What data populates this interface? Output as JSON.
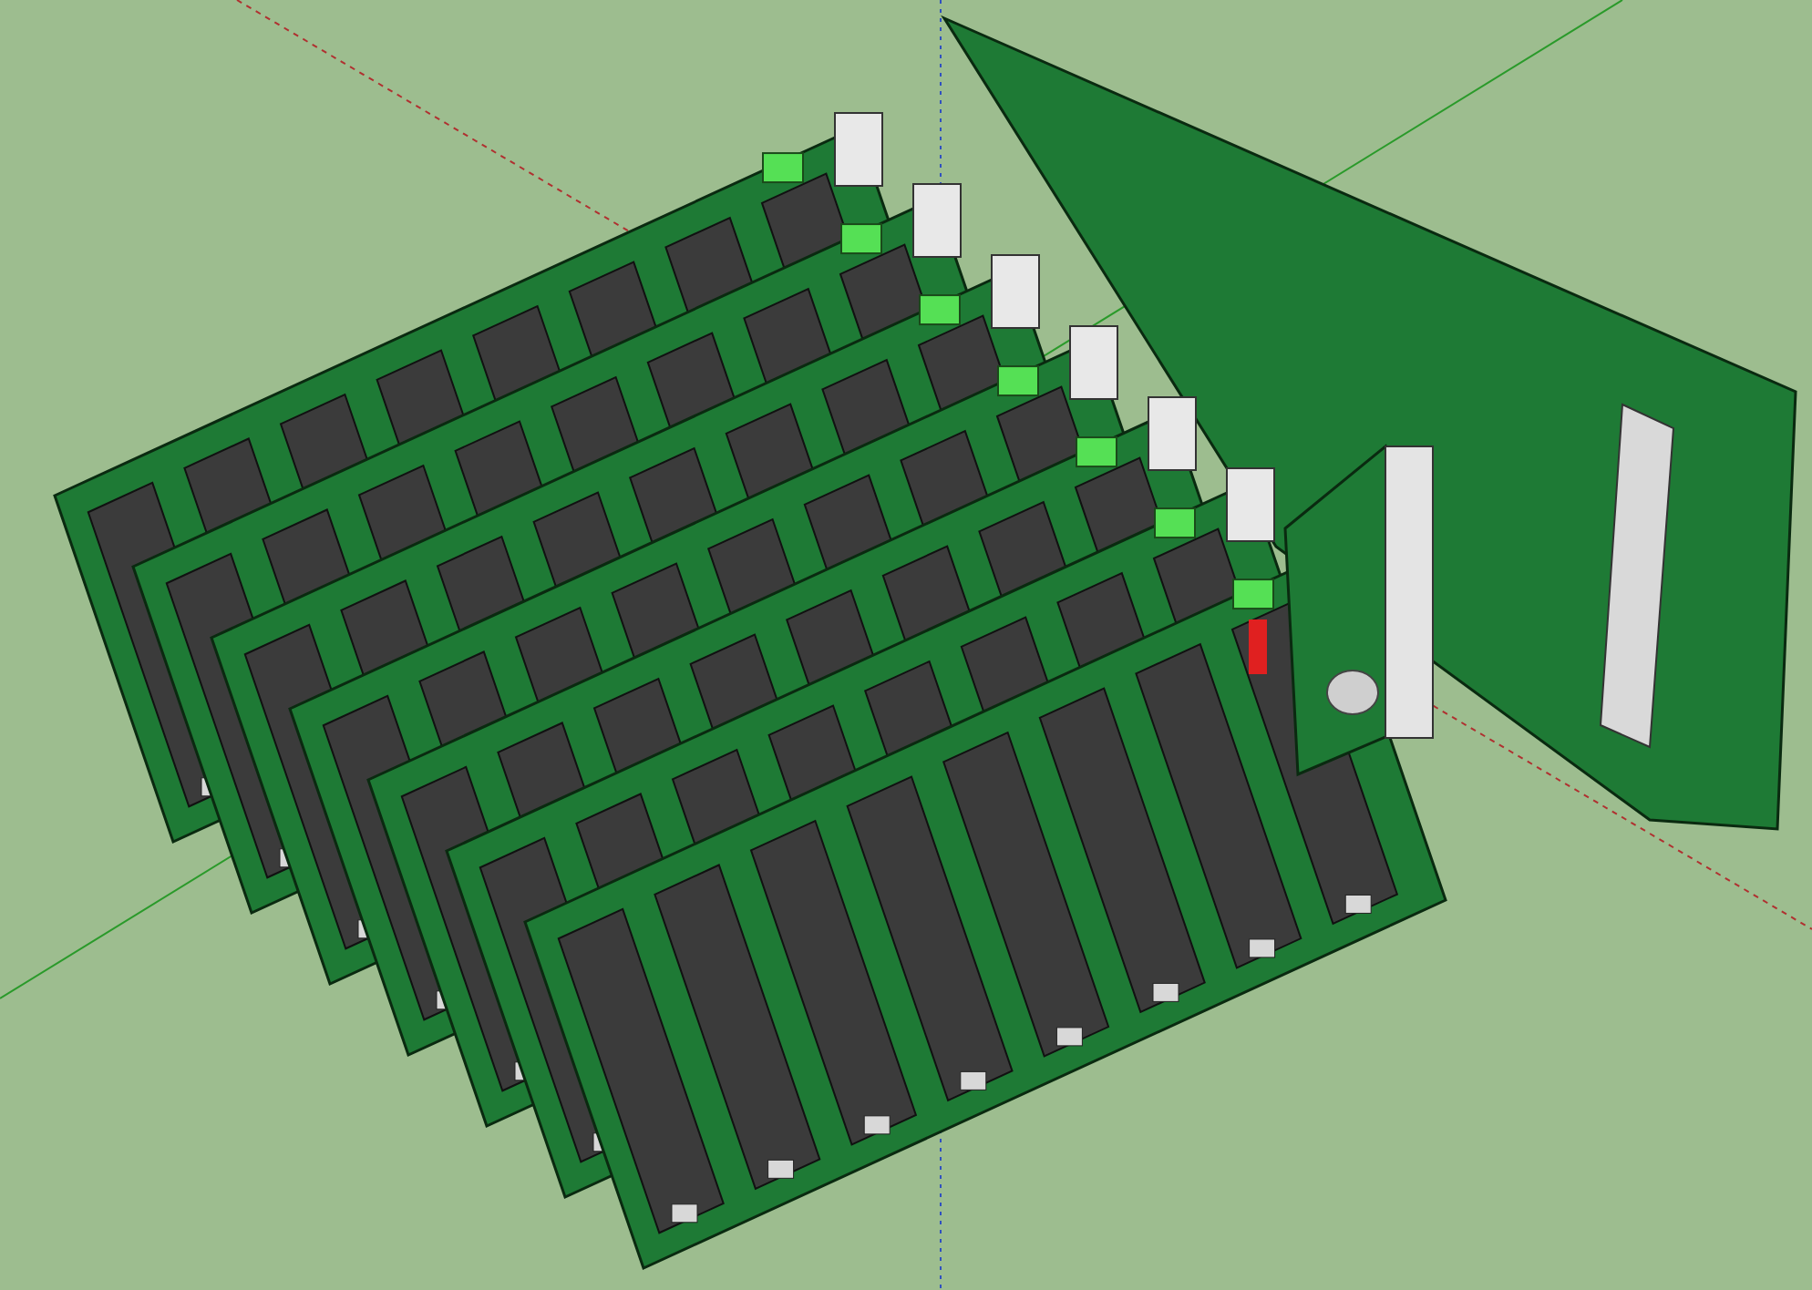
{
  "viewport": {
    "kind": "model-view",
    "boards": [
      {
        "kind": "battery-board"
      },
      {
        "kind": "battery-board"
      },
      {
        "kind": "battery-board"
      },
      {
        "kind": "battery-board"
      },
      {
        "kind": "battery-board"
      },
      {
        "kind": "battery-board"
      },
      {
        "kind": "battery-board"
      },
      {
        "kind": "controller-board"
      }
    ]
  }
}
